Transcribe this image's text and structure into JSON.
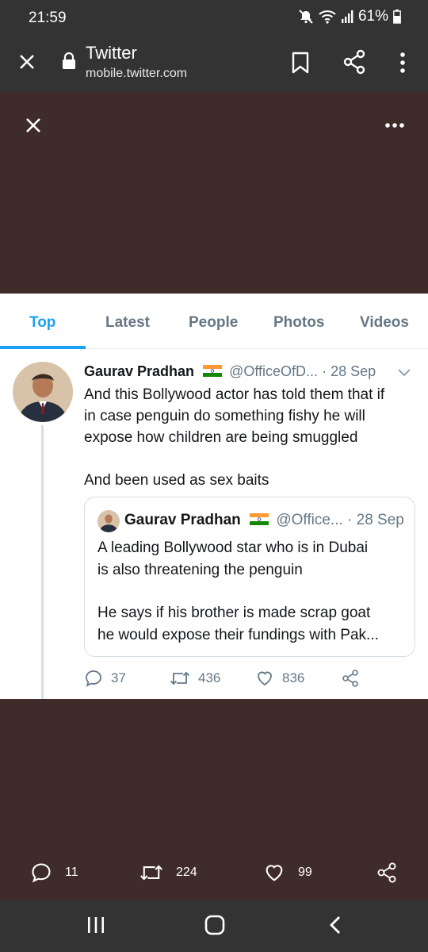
{
  "status_bar": {
    "time": "21:59",
    "battery": "61%"
  },
  "browser": {
    "title": "Twitter",
    "url": "mobile.twitter.com"
  },
  "tabs": [
    {
      "label": "Top",
      "active": true
    },
    {
      "label": "Latest",
      "active": false
    },
    {
      "label": "People",
      "active": false
    },
    {
      "label": "Photos",
      "active": false
    },
    {
      "label": "Videos",
      "active": false
    }
  ],
  "tweet": {
    "name": "Gaurav Pradhan",
    "handle": "@OfficeOfD...",
    "date": "· 28 Sep",
    "text_line1": "And this Bollywood actor has told them that if",
    "text_line2": "in case penguin do something fishy he will",
    "text_line3": "expose how children are being smuggled",
    "text_line4": "And been used as sex baits",
    "quote": {
      "name": "Gaurav Pradhan",
      "handle": "@Office...",
      "date": "· 28 Sep",
      "text_line1": "A leading Bollywood star who is in Dubai",
      "text_line2": "is also threatening the penguin",
      "text_line3": "He says if his brother is made scrap goat",
      "text_line4": "he would expose their fundings with Pak..."
    },
    "replies": "37",
    "retweets": "436",
    "likes": "836"
  },
  "bottom_bar": {
    "replies": "11",
    "retweets": "224",
    "likes": "99"
  },
  "colors": {
    "accent": "#1da1f2",
    "overlay": "#3f2b29",
    "chrome": "#333333",
    "muted": "#657786"
  }
}
